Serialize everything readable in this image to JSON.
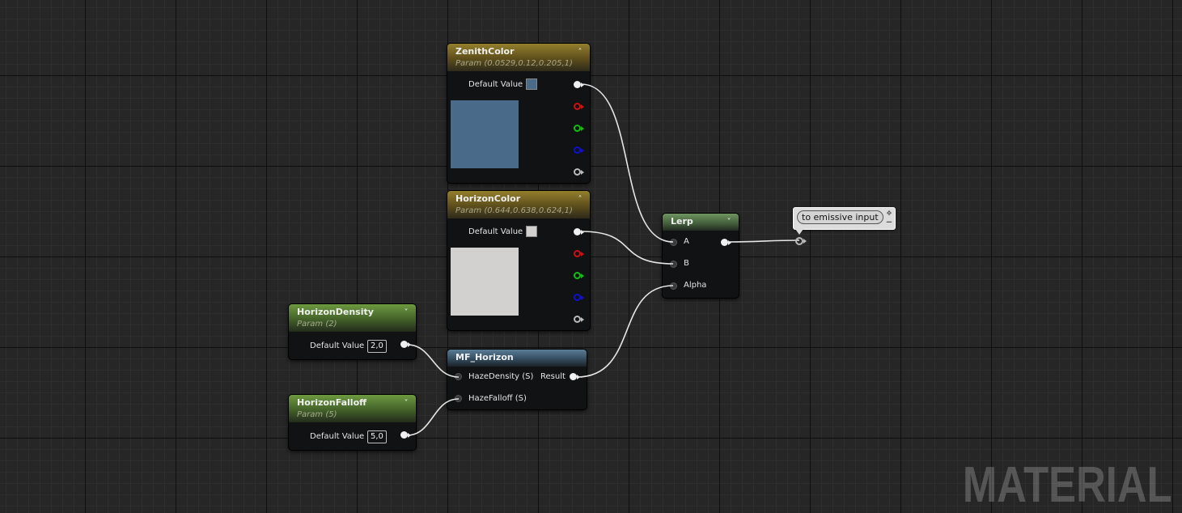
{
  "graph": {
    "watermark": "MATERIAL",
    "nodes": {
      "zenith_color": {
        "title": "ZenithColor",
        "subtitle": "Param (0.0529,0.12,0.205,1)",
        "default_label": "Default Value",
        "color": "#4a6a8a"
      },
      "horizon_color": {
        "title": "HorizonColor",
        "subtitle": "Param (0.644,0.638,0.624,1)",
        "default_label": "Default Value",
        "color": "#d2d1cf"
      },
      "horizon_density": {
        "title": "HorizonDensity",
        "subtitle": "Param (2)",
        "default_label": "Default Value",
        "value": "2,0"
      },
      "horizon_falloff": {
        "title": "HorizonFalloff",
        "subtitle": "Param (5)",
        "default_label": "Default Value",
        "value": "5,0"
      },
      "mf_horizon": {
        "title": "MF_Horizon",
        "inputs": [
          "HazeDensity (S)",
          "HazeFalloff (S)"
        ],
        "output": "Result"
      },
      "lerp": {
        "title": "Lerp",
        "inputs": [
          "A",
          "B",
          "Alpha"
        ]
      }
    },
    "comment": {
      "text": "to emissive input"
    },
    "icons": {
      "collapse_up": "chevron-up-icon",
      "collapse_down": "chevron-down-icon"
    }
  }
}
